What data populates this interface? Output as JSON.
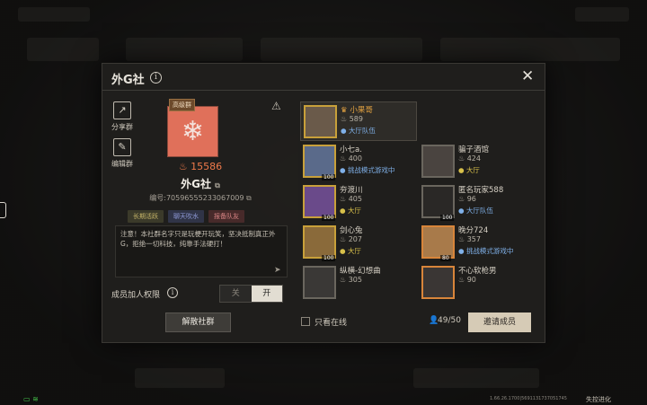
{
  "dialog": {
    "title": "外G社",
    "share_label": "分享群",
    "edit_label": "编辑群",
    "rank_tag": "高级群",
    "heat_value": "15586",
    "club_name": "外G社",
    "club_id": "编号:70596555233067009",
    "tags": [
      "长期活跃",
      "聊天吹水",
      "报备队友"
    ],
    "notice": "注意！本社群名字只是玩梗开玩笑，坚决抵制真正外G，拒绝一切科技，纯靠手法硬打！",
    "permission_label": "成员加人权限",
    "toggle_off": "关",
    "toggle_on": "开",
    "disband_label": "解散社群",
    "online_only_label": "只看在线",
    "member_count": "49/50",
    "invite_label": "邀请成员"
  },
  "members": [
    {
      "name": "小果哥",
      "heat": "589",
      "status": "大厅队伍",
      "status_type": "team",
      "owner": true,
      "level": ""
    },
    {
      "name": "小七a.",
      "heat": "400",
      "status": "挑战模式游戏中",
      "status_type": "game",
      "owner": false,
      "level": "100"
    },
    {
      "name": "骗子酒馆",
      "heat": "424",
      "status": "大厅",
      "status_type": "hall",
      "owner": false,
      "level": ""
    },
    {
      "name": "夯渡川",
      "heat": "405",
      "status": "大厅",
      "status_type": "hall",
      "owner": false,
      "level": "100"
    },
    {
      "name": "匿名玩家588",
      "heat": "96",
      "status": "大厅队伍",
      "status_type": "team",
      "owner": false,
      "level": "100"
    },
    {
      "name": "剑心兔",
      "heat": "207",
      "status": "大厅",
      "status_type": "hall",
      "owner": false,
      "level": "100"
    },
    {
      "name": "晚分724",
      "heat": "357",
      "status": "挑战模式游戏中",
      "status_type": "game",
      "owner": false,
      "level": "80"
    },
    {
      "name": "纵横-幻想曲",
      "heat": "305",
      "status": "",
      "status_type": "",
      "owner": false,
      "level": ""
    },
    {
      "name": "不心软枪男",
      "heat": "90",
      "status": "",
      "status_type": "",
      "owner": false,
      "level": ""
    }
  ],
  "footer": {
    "version": "1.66.26.1700|5691131737051745",
    "brand": "失控进化"
  }
}
